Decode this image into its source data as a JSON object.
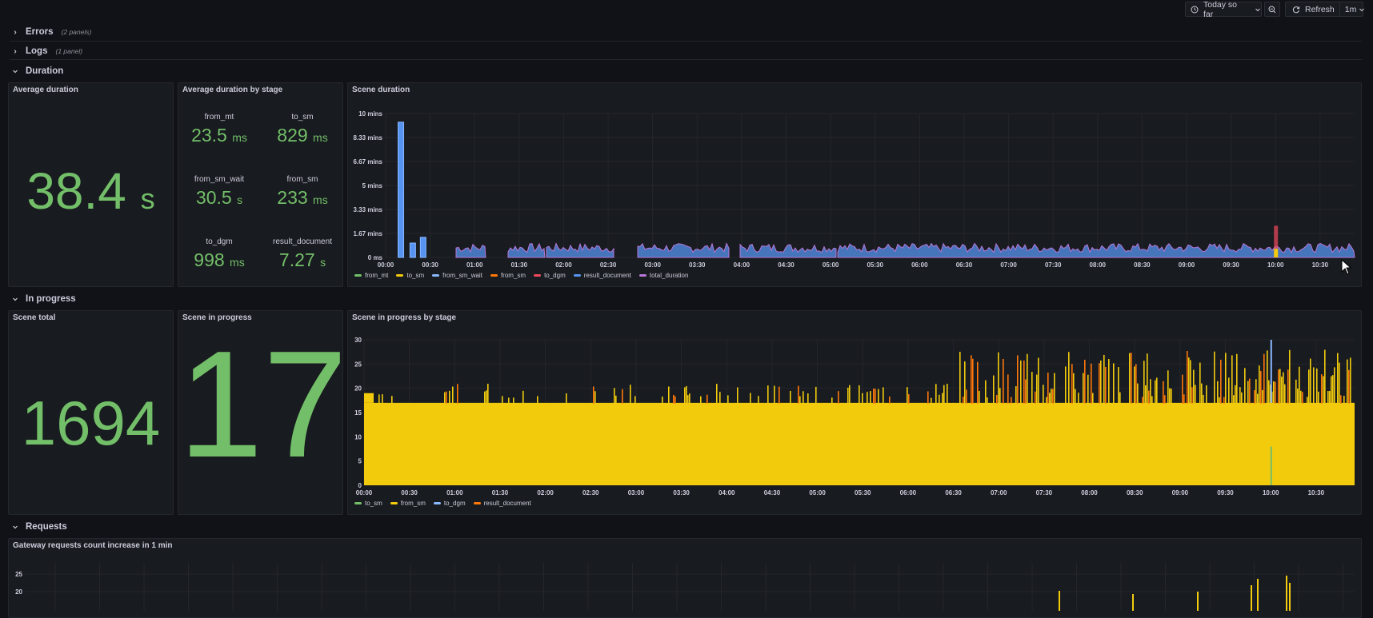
{
  "toolbar": {
    "time_range_label": "Today so far",
    "refresh_label": "Refresh",
    "interval_label": "1m"
  },
  "rows": {
    "errors": {
      "title": "Errors",
      "count": "(2 panels)"
    },
    "logs": {
      "title": "Logs",
      "count": "(1 panel)"
    },
    "duration": {
      "title": "Duration"
    },
    "in_progress": {
      "title": "In progress"
    },
    "requests": {
      "title": "Requests"
    }
  },
  "panels": {
    "avg_duration": {
      "title": "Average duration",
      "value": "38.4",
      "unit": "s"
    },
    "avg_by_stage": {
      "title": "Average duration by stage",
      "stages": [
        {
          "label": "from_mt",
          "value": "23.5",
          "unit": "ms"
        },
        {
          "label": "to_sm",
          "value": "829",
          "unit": "ms"
        },
        {
          "label": "from_sm_wait",
          "value": "30.5",
          "unit": "s"
        },
        {
          "label": "from_sm",
          "value": "233",
          "unit": "ms"
        },
        {
          "label": "to_dgm",
          "value": "998",
          "unit": "ms"
        },
        {
          "label": "result_document",
          "value": "7.27",
          "unit": "s"
        }
      ]
    },
    "scene_duration": {
      "title": "Scene duration"
    },
    "scene_total": {
      "title": "Scene total",
      "value": "1694"
    },
    "scene_in_progress": {
      "title": "Scene in progress",
      "value": "17"
    },
    "scene_by_stage": {
      "title": "Scene in progress by stage"
    },
    "gateway": {
      "title": "Gateway requests count increase in 1 min"
    }
  },
  "colors": {
    "green": "#73bf69",
    "yellow": "#f2cc0c",
    "blue": "#8ab8ff",
    "orange": "#ff780a",
    "red": "#f2495c",
    "blue2": "#5794f2",
    "purple": "#b877d9"
  },
  "icons": {
    "time_range": "clock-icon",
    "zoom_out": "zoom-out-icon",
    "refresh": "refresh-icon",
    "chevron": "chevron-down-icon"
  },
  "chart_data": [
    {
      "type": "area",
      "title": "Scene duration",
      "y_tick_labels": [
        "10 mins",
        "8.33 mins",
        "6.67 mins",
        "5 mins",
        "3.33 mins",
        "1.67 mins",
        "0 ms"
      ],
      "x_tick_labels": [
        "00:00",
        "00:30",
        "01:00",
        "01:30",
        "02:00",
        "02:30",
        "03:00",
        "03:30",
        "04:00",
        "04:30",
        "05:00",
        "05:30",
        "06:00",
        "06:30",
        "07:00",
        "07:30",
        "08:00",
        "08:30",
        "09:00",
        "09:30",
        "10:00",
        "10:30"
      ],
      "ylim_minutes": [
        0,
        10
      ],
      "legend": [
        "from_mt",
        "to_sm",
        "from_sm_wait",
        "from_sm",
        "to_dgm",
        "result_document",
        "total_duration"
      ],
      "legend_colors": [
        "#73bf69",
        "#f2cc0c",
        "#8ab8ff",
        "#ff780a",
        "#f2495c",
        "#5794f2",
        "#b877d9"
      ],
      "spikes_minutes": [
        {
          "time": "00:10",
          "value": 9.4
        },
        {
          "time": "00:18",
          "value": 1.0
        },
        {
          "time": "00:25",
          "value": 1.4
        }
      ],
      "baseline_minutes": 0.7,
      "grid": true,
      "legend_position": "bottom-left"
    },
    {
      "type": "bar",
      "title": "Scene in progress by stage",
      "y_tick_labels": [
        "30",
        "25",
        "20",
        "15",
        "10",
        "5",
        "0"
      ],
      "x_tick_labels": [
        "00:00",
        "00:30",
        "01:00",
        "01:30",
        "02:00",
        "02:30",
        "03:00",
        "03:30",
        "04:00",
        "04:30",
        "05:00",
        "05:30",
        "06:00",
        "06:30",
        "07:00",
        "07:30",
        "08:00",
        "08:30",
        "09:00",
        "09:30",
        "10:00",
        "10:30"
      ],
      "ylim": [
        0,
        30
      ],
      "legend": [
        "to_sm",
        "from_sm",
        "to_dgm",
        "result_document"
      ],
      "legend_colors": [
        "#73bf69",
        "#f2cc0c",
        "#8ab8ff",
        "#ff780a"
      ],
      "baseline": 17,
      "max_peak": 30,
      "grid": true,
      "legend_position": "bottom-left"
    },
    {
      "type": "bar",
      "title": "Gateway requests count increase in 1 min",
      "y_tick_labels": [
        "25",
        "20"
      ],
      "visible_peak": 25,
      "grid": true
    }
  ]
}
